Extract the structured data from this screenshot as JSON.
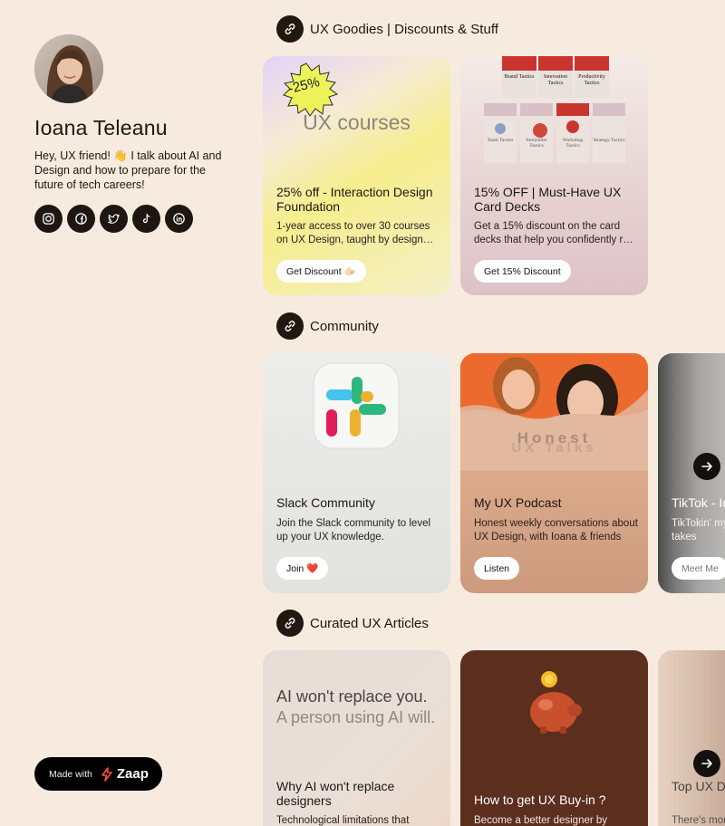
{
  "profile": {
    "name": "Ioana Teleanu",
    "bio": "Hey, UX friend! 👋 I talk about AI and Design and how to prepare for the future of tech careers!",
    "socials": [
      {
        "icon": "instagram-icon"
      },
      {
        "icon": "facebook-icon"
      },
      {
        "icon": "twitter-icon"
      },
      {
        "icon": "tiktok-icon"
      },
      {
        "icon": "linkedin-icon"
      }
    ]
  },
  "made_with": {
    "label": "Made with",
    "brand": "Zaap"
  },
  "sections": {
    "goodies": {
      "title": "UX Goodies | Discounts & Stuff",
      "cards": [
        {
          "badge": "-25%",
          "image_text": "UX courses",
          "title": "25% off - Interaction Design Foundation",
          "desc": "1-year access to over 30 courses on UX Design, taught by design experts",
          "button": "Get Discount 🫱🏻"
        },
        {
          "deck_titles": [
            "Brand Tactics",
            "Innovation Tactics",
            "Productivity Tactics",
            "Team Tactics",
            "Storyteller Tactics",
            "Workshop Tactics",
            "Strategy Tactics"
          ],
          "title": "15% OFF | Must-Have UX Card Decks",
          "desc": "Get a 15% discount on the card decks that help you confidently run workshops",
          "button": "Get 15% Discount"
        }
      ]
    },
    "community": {
      "title": "Community",
      "cards": [
        {
          "title": "Slack Community",
          "desc": "Join the Slack community to level up your UX knowledge.",
          "button": "Join ❤️"
        },
        {
          "image_text_1": "Honest",
          "image_text_2": "UX Talks",
          "title": "My UX Podcast",
          "desc": "Honest weekly conversations about UX Design, with Ioana & friends",
          "button": "Listen"
        },
        {
          "title": "TikTok - Ioana",
          "desc": "TikTokin' my way through ranty UX takes",
          "button": "Meet Me"
        }
      ]
    },
    "articles": {
      "title": "Curated UX Articles",
      "cards": [
        {
          "image_line_1": "AI won't replace you.",
          "image_line_2": "A person using AI will.",
          "title": "Why AI won't replace designers",
          "desc": "Technological limitations that"
        },
        {
          "title": "How to get UX Buy-in ?",
          "desc": "Become a better designer by"
        },
        {
          "title": "Top UX Designers",
          "desc": "There's more to"
        }
      ]
    }
  },
  "colors": {
    "background": "#f6ebde",
    "dark": "#1c1712",
    "podcast_card": "#d8a788",
    "buyin_card": "#5b2e1e"
  }
}
